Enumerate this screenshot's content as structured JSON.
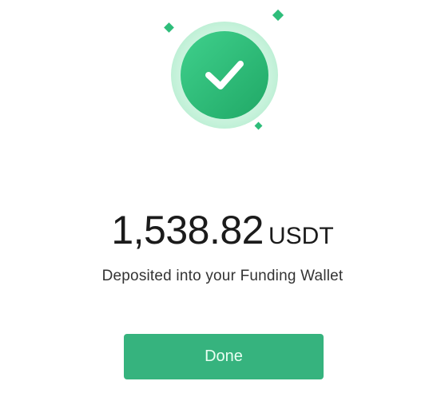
{
  "success": {
    "icon": "checkmark-success-icon",
    "accent_color": "#2ebd7a",
    "button_color": "#36b37e"
  },
  "deposit": {
    "amount": "1,538.82",
    "currency": "USDT",
    "message": "Deposited into your Funding Wallet"
  },
  "actions": {
    "done_label": "Done"
  }
}
